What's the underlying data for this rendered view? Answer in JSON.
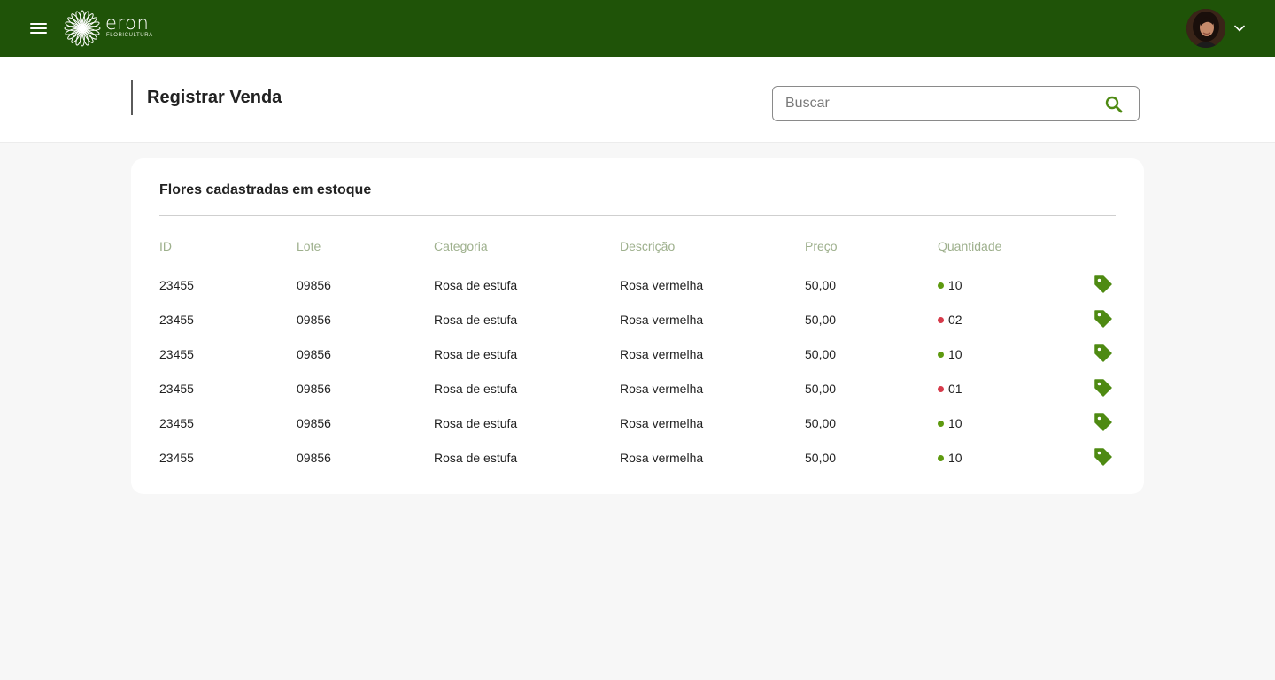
{
  "app": {
    "brand_name": "eron",
    "brand_sub": "FLORICULTURA",
    "colors": {
      "topbar": "#1f5308",
      "accent": "#4e8a12",
      "ok": "#5e9a0f",
      "low": "#d63a4a",
      "header_text": "#9eb08d"
    }
  },
  "header": {
    "title": "Registrar Venda",
    "search_placeholder": "Buscar"
  },
  "table": {
    "title": "Flores cadastradas em estoque",
    "columns": [
      "ID",
      "Lote",
      "Categoria",
      "Descrição",
      "Preço",
      "Quantidade"
    ],
    "rows": [
      {
        "id": "23455",
        "lote": "09856",
        "categoria": "Rosa de estufa",
        "descricao": "Rosa vermelha",
        "preco": "50,00",
        "quantidade": "10",
        "status": "ok"
      },
      {
        "id": "23455",
        "lote": "09856",
        "categoria": "Rosa de estufa",
        "descricao": "Rosa vermelha",
        "preco": "50,00",
        "quantidade": "02",
        "status": "low"
      },
      {
        "id": "23455",
        "lote": "09856",
        "categoria": "Rosa de estufa",
        "descricao": "Rosa vermelha",
        "preco": "50,00",
        "quantidade": "10",
        "status": "ok"
      },
      {
        "id": "23455",
        "lote": "09856",
        "categoria": "Rosa de estufa",
        "descricao": "Rosa vermelha",
        "preco": "50,00",
        "quantidade": "01",
        "status": "low"
      },
      {
        "id": "23455",
        "lote": "09856",
        "categoria": "Rosa de estufa",
        "descricao": "Rosa vermelha",
        "preco": "50,00",
        "quantidade": "10",
        "status": "ok"
      },
      {
        "id": "23455",
        "lote": "09856",
        "categoria": "Rosa de estufa",
        "descricao": "Rosa vermelha",
        "preco": "50,00",
        "quantidade": "10",
        "status": "ok"
      }
    ],
    "row_icon": "tag-icon"
  }
}
